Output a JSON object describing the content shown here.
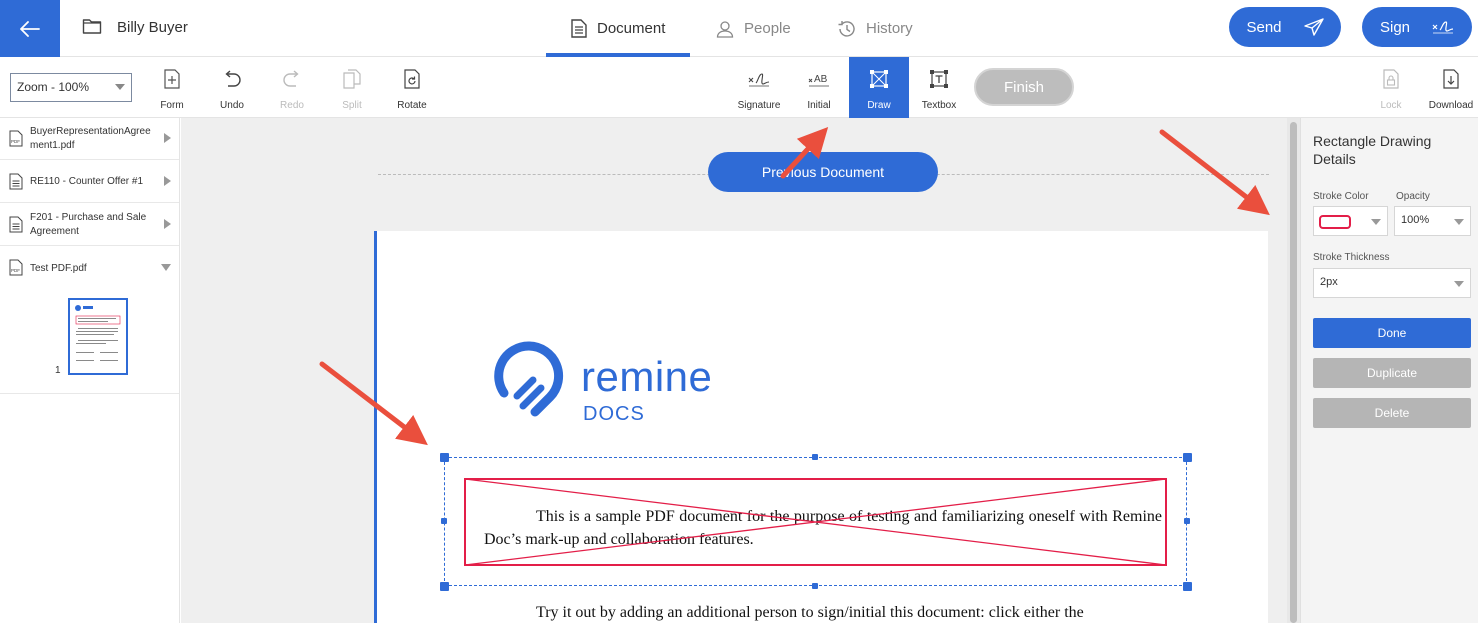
{
  "header": {
    "deal_title": "Billy Buyer",
    "tabs": [
      {
        "label": "Document",
        "icon": "document-icon",
        "active": true
      },
      {
        "label": "People",
        "icon": "person-icon",
        "active": false
      },
      {
        "label": "History",
        "icon": "history-icon",
        "active": false
      }
    ],
    "send_label": "Send",
    "sign_label": "Sign",
    "accent_color": "#2f6bd6"
  },
  "toolbar": {
    "zoom_value": "Zoom - 100%",
    "tools": {
      "form": "Form",
      "undo": "Undo",
      "redo": "Redo",
      "split": "Split",
      "rotate": "Rotate",
      "signature": "Signature",
      "initial": "Initial",
      "draw": "Draw",
      "textbox": "Textbox",
      "lock": "Lock",
      "download": "Download"
    },
    "finish_label": "Finish",
    "active_tool": "Draw"
  },
  "sidebar": {
    "files": [
      {
        "name": "BuyerRepresentationAgreement1.pdf",
        "line1": "BuyerRepresentationAgree",
        "line2": "ment1.pdf",
        "expanded": false
      },
      {
        "name": "RE110 - Counter Offer #1",
        "expanded": false
      },
      {
        "name": "F201 - Purchase and Sale Agreement",
        "line1": "F201 - Purchase and Sale",
        "line2": "Agreement",
        "expanded": false
      },
      {
        "name": "Test PDF.pdf",
        "expanded": true
      }
    ],
    "page_thumbnail_number": "1"
  },
  "canvas": {
    "previous_document_label": "Previous Document",
    "logo_word": "remine",
    "logo_sub": "DOCS",
    "paragraph1": "This is a sample PDF document for the purpose of testing and familiarizing oneself with Remine Doc’s mark-up and collaboration features.",
    "paragraph2": "Try it out by adding an additional person to sign/initial this document: click either the",
    "drawing_color": "#e31e48"
  },
  "right_panel": {
    "title": "Rectangle Drawing Details",
    "stroke_color_label": "Stroke Color",
    "opacity_label": "Opacity",
    "opacity_value": "100%",
    "stroke_thickness_label": "Stroke Thickness",
    "stroke_thickness_value": "2px",
    "done_label": "Done",
    "duplicate_label": "Duplicate",
    "delete_label": "Delete"
  }
}
